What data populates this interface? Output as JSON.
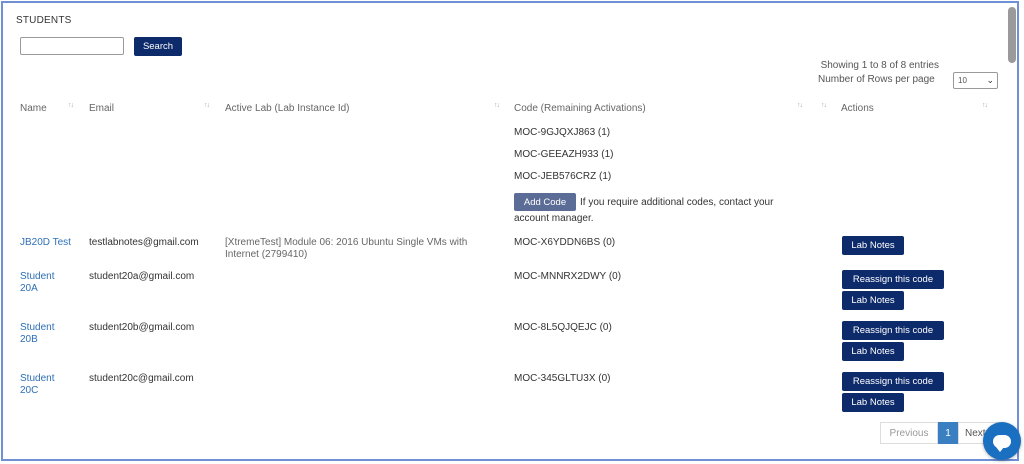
{
  "section": {
    "title": "STUDENTS"
  },
  "search": {
    "value": "",
    "placeholder": "",
    "button_label": "Search"
  },
  "paging_info": {
    "summary": "Showing 1 to 8 of 8 entries",
    "rows_label": "Number of Rows per page",
    "rows_value": "10"
  },
  "columns": [
    "Name",
    "Email",
    "Active Lab (Lab Instance Id)",
    "Code (Remaining Activations)",
    "Actions"
  ],
  "unassigned_codes": [
    "MOC-9GJQXJ863 (1)",
    "MOC-GEEAZH933 (1)",
    "MOC-JEB576CRZ (1)"
  ],
  "add_code": {
    "button_label": "Add Code",
    "message_1": "If you require additional codes, contact your",
    "message_2": "account manager."
  },
  "students": [
    {
      "name_1": "JB20D Test",
      "name_2": "",
      "email": "testlabnotes@gmail.com",
      "lab_1": "[XtremeTest] Module 06: 2016 Ubuntu Single VMs with",
      "lab_2": "Internet (2799410)",
      "code": "MOC-X6YDDN6BS (0)",
      "reassign_label": "",
      "lab_notes_label": "Lab Notes"
    },
    {
      "name_1": "Student",
      "name_2": "20A",
      "email": "student20a@gmail.com",
      "lab_1": "",
      "lab_2": "",
      "code": "MOC-MNNRX2DWY (0)",
      "reassign_label": "Reassign this code",
      "lab_notes_label": "Lab Notes"
    },
    {
      "name_1": "Student",
      "name_2": "20B",
      "email": "student20b@gmail.com",
      "lab_1": "",
      "lab_2": "",
      "code": "MOC-8L5QJQEJC (0)",
      "reassign_label": "Reassign this code",
      "lab_notes_label": "Lab Notes"
    },
    {
      "name_1": "Student",
      "name_2": "20C",
      "email": "student20c@gmail.com",
      "lab_1": "",
      "lab_2": "",
      "code": "MOC-345GLTU3X (0)",
      "reassign_label": "Reassign this code",
      "lab_notes_label": "Lab Notes"
    }
  ],
  "pagination": {
    "previous": "Previous",
    "current": "1",
    "next": "Next"
  },
  "colors": {
    "primary": "#0d2a6b",
    "link": "#2d6fb5",
    "add_code": "#5b6d96",
    "active_page": "#3a7fc1",
    "frame": "#6f8fd6"
  }
}
